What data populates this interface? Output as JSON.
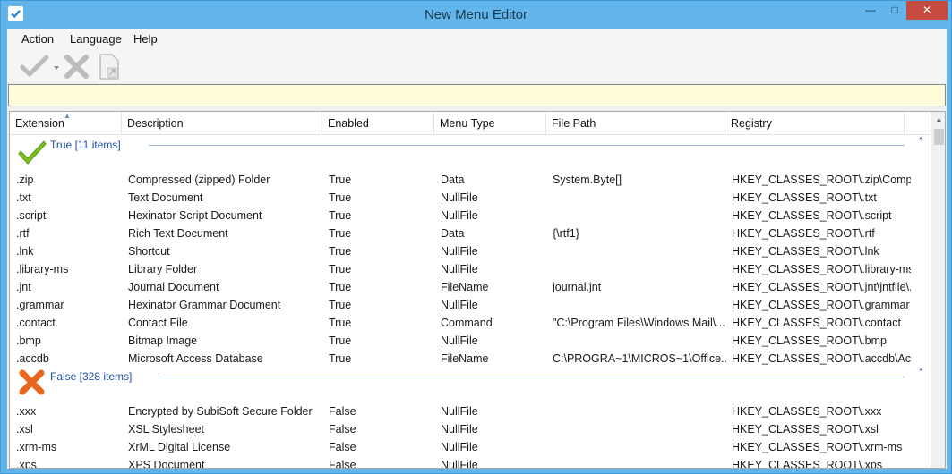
{
  "window": {
    "title": "New Menu Editor"
  },
  "menubar": {
    "items": [
      "Action",
      "Language",
      "Help"
    ]
  },
  "search": {
    "value": "",
    "color": "#fffcd9"
  },
  "columns": [
    "Extension",
    "Description",
    "Enabled",
    "Menu Type",
    "File Path",
    "Registry"
  ],
  "groups": [
    {
      "label": "True [11 items]",
      "icon": "check-icon",
      "rows": [
        [
          ".zip",
          "Compressed (zipped) Folder",
          "True",
          "Data",
          "System.Byte[]",
          "HKEY_CLASSES_ROOT\\.zip\\Comp..."
        ],
        [
          ".txt",
          "Text Document",
          "True",
          "NullFile",
          "",
          "HKEY_CLASSES_ROOT\\.txt"
        ],
        [
          ".script",
          "Hexinator Script Document",
          "True",
          "NullFile",
          "",
          "HKEY_CLASSES_ROOT\\.script"
        ],
        [
          ".rtf",
          "Rich Text Document",
          "True",
          "Data",
          "{\\rtf1}",
          "HKEY_CLASSES_ROOT\\.rtf"
        ],
        [
          ".lnk",
          "Shortcut",
          "True",
          "NullFile",
          "",
          "HKEY_CLASSES_ROOT\\.lnk"
        ],
        [
          ".library-ms",
          "Library Folder",
          "True",
          "NullFile",
          "",
          "HKEY_CLASSES_ROOT\\.library-ms"
        ],
        [
          ".jnt",
          "Journal Document",
          "True",
          "FileName",
          "journal.jnt",
          "HKEY_CLASSES_ROOT\\.jnt\\jntfile\\..."
        ],
        [
          ".grammar",
          "Hexinator Grammar Document",
          "True",
          "NullFile",
          "",
          "HKEY_CLASSES_ROOT\\.grammar"
        ],
        [
          ".contact",
          "Contact File",
          "True",
          "Command",
          "\"C:\\Program Files\\Windows Mail\\...",
          "HKEY_CLASSES_ROOT\\.contact"
        ],
        [
          ".bmp",
          "Bitmap Image",
          "True",
          "NullFile",
          "",
          "HKEY_CLASSES_ROOT\\.bmp"
        ],
        [
          ".accdb",
          "Microsoft Access Database",
          "True",
          "FileName",
          "C:\\PROGRA~1\\MICROS~1\\Office...",
          "HKEY_CLASSES_ROOT\\.accdb\\Ac..."
        ]
      ]
    },
    {
      "label": "False [328 items]",
      "icon": "cross-icon",
      "rows": [
        [
          ".xxx",
          "Encrypted by SubiSoft Secure Folder",
          "False",
          "NullFile",
          "",
          "HKEY_CLASSES_ROOT\\.xxx"
        ],
        [
          ".xsl",
          "XSL Stylesheet",
          "False",
          "NullFile",
          "",
          "HKEY_CLASSES_ROOT\\.xsl"
        ],
        [
          ".xrm-ms",
          "XrML Digital License",
          "False",
          "NullFile",
          "",
          "HKEY_CLASSES_ROOT\\.xrm-ms"
        ],
        [
          ".xps",
          "XPS Document",
          "False",
          "NullFile",
          "",
          "HKEY_CLASSES_ROOT\\.xps"
        ]
      ]
    }
  ],
  "colors": {
    "titlebar": "#62b5ea",
    "group_text": "#1f4e9e",
    "check": "#7cc21e",
    "cross": "#e8661e"
  }
}
